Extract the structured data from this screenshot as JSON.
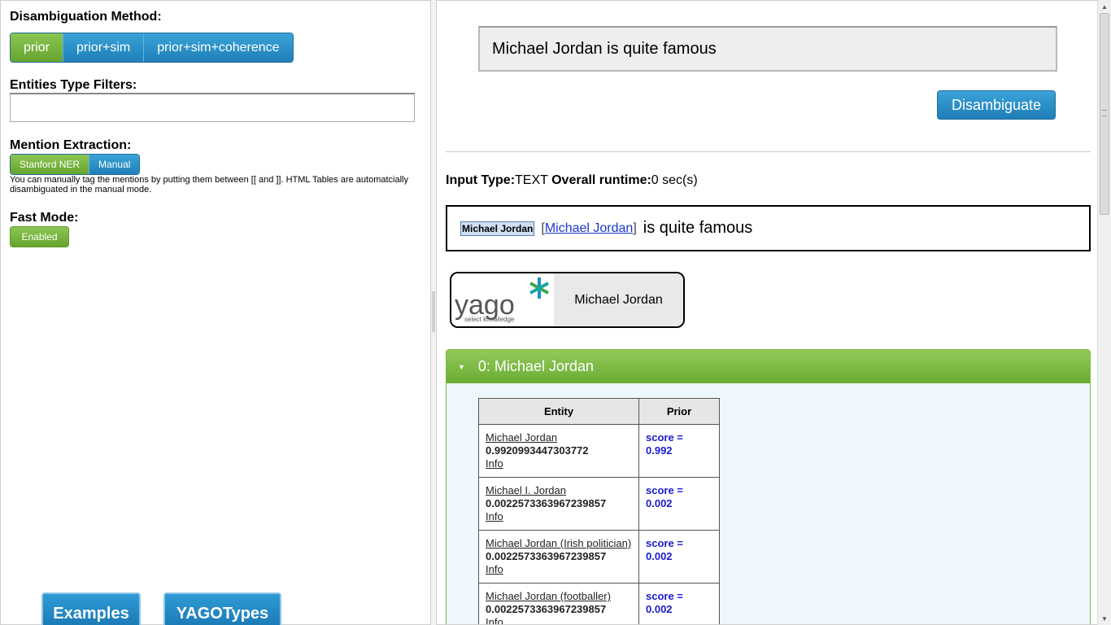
{
  "left": {
    "method_label": "Disambiguation Method:",
    "methods": [
      "prior",
      "prior+sim",
      "prior+sim+coherence"
    ],
    "active_method": "prior",
    "filters_label": "Entities Type Filters:",
    "filters_value": "",
    "mention_label": "Mention Extraction:",
    "mention_options": [
      "Stanford NER",
      "Manual"
    ],
    "active_mention": "Stanford NER",
    "mention_note": "You can manually tag the mentions by putting them between [[ and ]]. HTML Tables are automatcially disambiguated in the manual mode.",
    "fast_label": "Fast Mode:",
    "fast_value": "Enabled",
    "examples_button": "Examples",
    "yagotypes_button": "YAGOTypes"
  },
  "right": {
    "input_text": "Michael Jordan is quite famous",
    "disambiguate_button": "Disambiguate",
    "input_type_label": "Input Type:",
    "input_type_value": "TEXT",
    "runtime_label": "Overall runtime:",
    "runtime_value": "0 sec(s)",
    "result": {
      "mention": "Michael Jordan",
      "bracket_open": "[",
      "entity": "Michael Jordan",
      "bracket_close": "]",
      "rest": "is quite famous"
    },
    "yago_card": {
      "logo_text": "yago",
      "logo_tagline": "select knowledge",
      "entity": "Michael Jordan"
    },
    "accordion_title": "0: Michael Jordan",
    "table": {
      "headers": [
        "Entity",
        "Prior"
      ],
      "rows": [
        {
          "name": "Michael Jordan",
          "value": "0.9920993447303772",
          "info": "Info",
          "score": "score = 0.992"
        },
        {
          "name": "Michael I. Jordan",
          "value": "0.0022573363967239857",
          "info": "Info",
          "score": "score = 0.002"
        },
        {
          "name": "Michael Jordan (Irish politician)",
          "value": "0.0022573363967239857",
          "info": "Info",
          "score": "score = 0.002"
        },
        {
          "name": "Michael Jordan (footballer)",
          "value": "0.0022573363967239857",
          "info": "Info",
          "score": "score = 0.002"
        }
      ]
    }
  },
  "colors": {
    "blue_button": "#1f7eb8",
    "green_active": "#6aad33",
    "link_blue": "#1a38c8",
    "score_blue": "#1a1ad0"
  }
}
